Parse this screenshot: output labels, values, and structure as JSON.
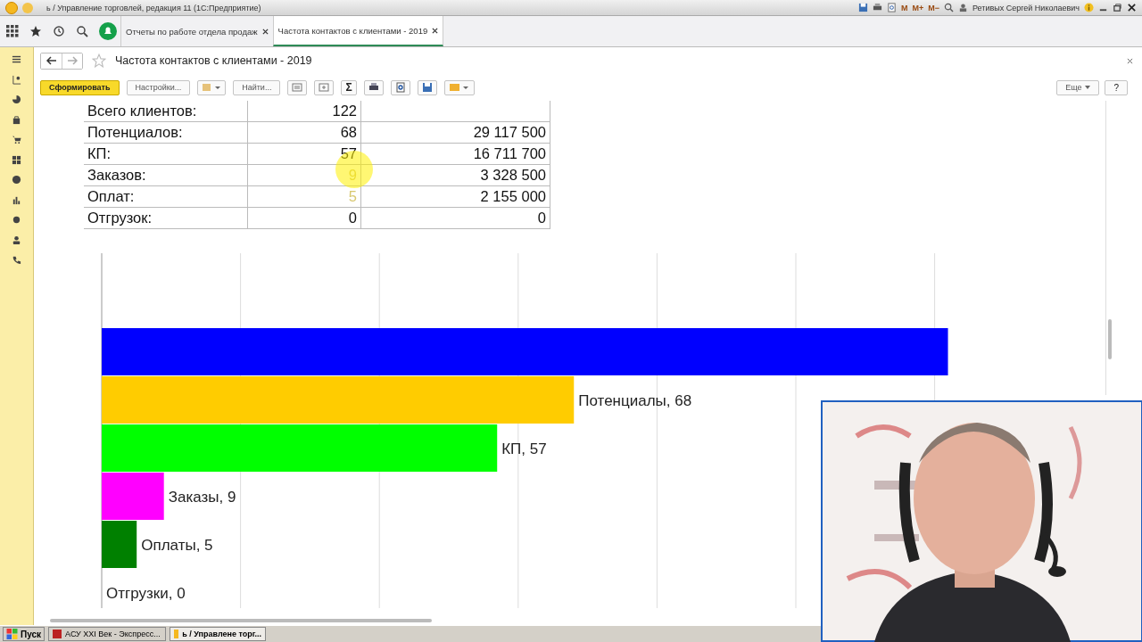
{
  "window": {
    "title": "ь / Управление торговлей, редакция 11  (1С:Предприятие)",
    "user": "Ретивых Сергей Николаевич",
    "memory_buttons": [
      "M",
      "M+",
      "M−"
    ]
  },
  "tabs": [
    {
      "label": "Отчеты по работе отдела продаж",
      "selected": false
    },
    {
      "label": "Частота контактов с клиентами - 2019",
      "selected": true
    }
  ],
  "form": {
    "title": "Частота контактов с клиентами - 2019",
    "toolbar": {
      "generate": "Сформировать",
      "settings": "Настройки...",
      "find": "Найти...",
      "sum": "Σ",
      "more": "Еще",
      "help": "?"
    }
  },
  "table": {
    "rows": [
      {
        "label": "Всего клиентов:",
        "count": "122"
      },
      {
        "label": "Потенциалов:",
        "count": "68",
        "amount": "29 117 500"
      },
      {
        "label": "КП:",
        "count": "57",
        "amount": "16 711 700"
      },
      {
        "label": "Заказов:",
        "count": "9",
        "amount": "3 328 500"
      },
      {
        "label": "Оплат:",
        "count": "5",
        "amount": "2 155 000"
      },
      {
        "label": "Отгрузок:",
        "count": "0",
        "amount": "0"
      }
    ]
  },
  "bar_chart": {
    "bars": [
      {
        "color": "#0000ff",
        "level": 0.871
      },
      {
        "color": "#ffcc00",
        "level": 0.486,
        "label": "Потенциалы, 68"
      },
      {
        "color": "#00ff00",
        "level": 0.407,
        "label": "КП, 57"
      },
      {
        "color": "#ff00ff",
        "level": 0.064,
        "label": "Заказы, 9"
      },
      {
        "color": "#008000",
        "level": 0.036,
        "label": "Оплаты, 5"
      },
      {
        "label": "Отгрузки, 0"
      }
    ]
  },
  "taskbar": {
    "start": "Пуск",
    "items": [
      {
        "label": "АСУ XXI Век - Экспресс...",
        "selected": false
      },
      {
        "label": "ь / Управлене торг...",
        "selected": true
      }
    ]
  }
}
